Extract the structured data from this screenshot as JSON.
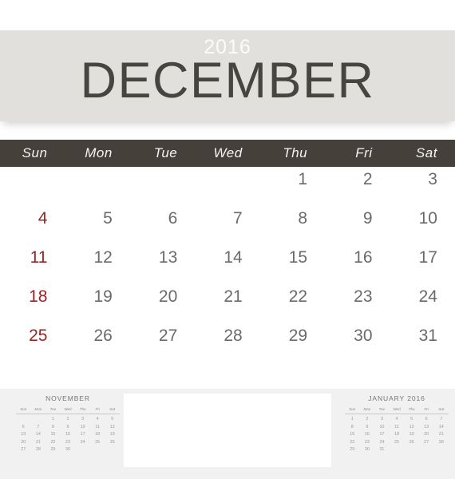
{
  "header": {
    "year": "2016",
    "month": "DECEMBER",
    "banner_color": "#e1e0dc",
    "month_color": "#464540",
    "year_color": "#fbfbfa"
  },
  "weekday_bar": {
    "background": "#45413a",
    "text_color": "#f4f3f0",
    "labels": [
      "Sun",
      "Mon",
      "Tue",
      "Wed",
      "Thu",
      "Fri",
      "Sat"
    ]
  },
  "main_calendar": {
    "sunday_color": "#9c2222",
    "weekday_color": "#6a6a6a",
    "weeks": [
      [
        "",
        "",
        "",
        "",
        "1",
        "2",
        "3"
      ],
      [
        "4",
        "5",
        "6",
        "7",
        "8",
        "9",
        "10"
      ],
      [
        "11",
        "12",
        "13",
        "14",
        "15",
        "16",
        "17"
      ],
      [
        "18",
        "19",
        "20",
        "21",
        "22",
        "23",
        "24"
      ],
      [
        "25",
        "26",
        "27",
        "28",
        "29",
        "30",
        "31"
      ]
    ]
  },
  "footer": {
    "background": "#f1f1f1",
    "notes_box_color": "#ffffff"
  },
  "mini_prev": {
    "title": "NOVEMBER",
    "weekday_labels": [
      "Sun",
      "Mon",
      "Tue",
      "Wed",
      "Thu",
      "Fri",
      "Sat"
    ],
    "weeks": [
      [
        "",
        "",
        "1",
        "2",
        "3",
        "4",
        "5"
      ],
      [
        "6",
        "7",
        "8",
        "9",
        "10",
        "11",
        "12"
      ],
      [
        "13",
        "14",
        "15",
        "16",
        "17",
        "18",
        "19"
      ],
      [
        "20",
        "21",
        "22",
        "23",
        "24",
        "25",
        "26"
      ],
      [
        "27",
        "28",
        "29",
        "30",
        "",
        "",
        ""
      ]
    ]
  },
  "mini_next": {
    "title": "JANUARY 2016",
    "weekday_labels": [
      "Sun",
      "Mon",
      "Tue",
      "Wed",
      "Thu",
      "Fri",
      "Sat"
    ],
    "weeks": [
      [
        "1",
        "2",
        "3",
        "4",
        "5",
        "6",
        "7"
      ],
      [
        "8",
        "9",
        "10",
        "11",
        "12",
        "13",
        "14"
      ],
      [
        "15",
        "16",
        "17",
        "18",
        "19",
        "20",
        "21"
      ],
      [
        "22",
        "23",
        "24",
        "25",
        "26",
        "27",
        "28"
      ],
      [
        "29",
        "30",
        "31",
        "",
        "",
        "",
        ""
      ]
    ]
  }
}
